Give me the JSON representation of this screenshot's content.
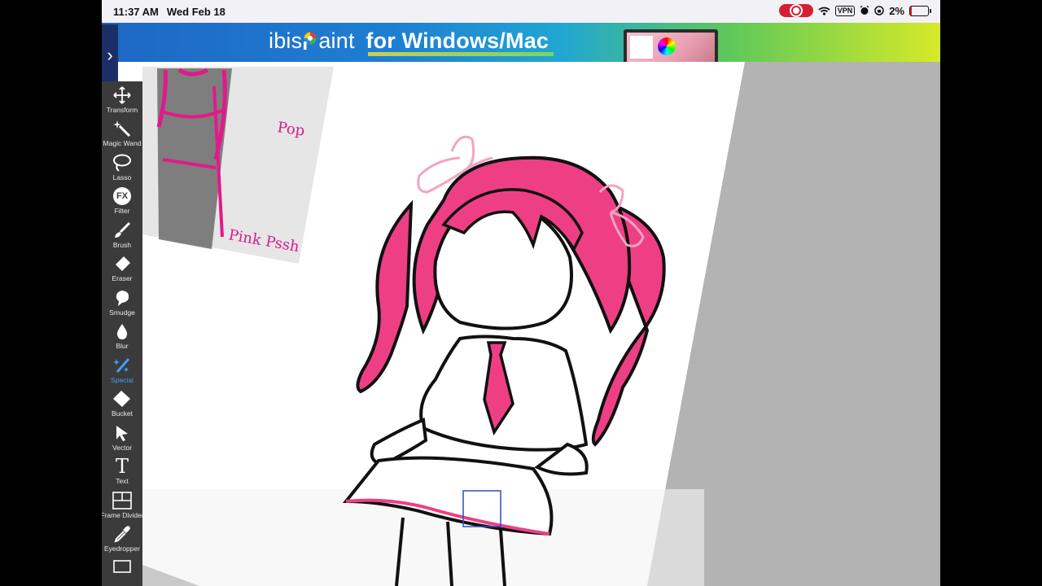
{
  "status_bar": {
    "time": "11:37 AM",
    "date": "Wed Feb 18",
    "vpn_label": "VPN",
    "battery_percent": "2%"
  },
  "banner": {
    "brand_prefix": "ibis",
    "brand_suffix": "aint",
    "tagline": "for Windows/Mac"
  },
  "sidebar_toggle": "›",
  "reference_image": {
    "label_1": "Pop",
    "label_2": "Pink Pssh"
  },
  "toolbar": {
    "active_tool": "Special",
    "tools": [
      {
        "label": "Transform",
        "icon": "move-arrows-icon"
      },
      {
        "label": "Magic Wand",
        "icon": "magic-wand-icon"
      },
      {
        "label": "Lasso",
        "icon": "lasso-icon"
      },
      {
        "label": "Filter",
        "icon": "fx-icon",
        "glyph": "FX"
      },
      {
        "label": "Brush",
        "icon": "brush-icon"
      },
      {
        "label": "Eraser",
        "icon": "eraser-icon"
      },
      {
        "label": "Smudge",
        "icon": "smudge-icon"
      },
      {
        "label": "Blur",
        "icon": "blur-drop-icon"
      },
      {
        "label": "Special",
        "icon": "special-sparkle-brush-icon"
      },
      {
        "label": "Bucket",
        "icon": "bucket-icon"
      },
      {
        "label": "Vector",
        "icon": "vector-pointer-icon"
      },
      {
        "label": "Text",
        "icon": "text-icon",
        "glyph": "T"
      },
      {
        "label": "Frame Divider",
        "icon": "frame-divider-icon"
      },
      {
        "label": "Eyedropper",
        "icon": "eyedropper-icon"
      }
    ]
  },
  "colors": {
    "hair_pink": "#ee3f84",
    "ribbon_light_pink": "#f3a3c4",
    "outline": "#111111",
    "active_tool_blue": "#3ea0ff",
    "record_red": "#d61f32",
    "canvas_gray": "#b3b3b3"
  }
}
